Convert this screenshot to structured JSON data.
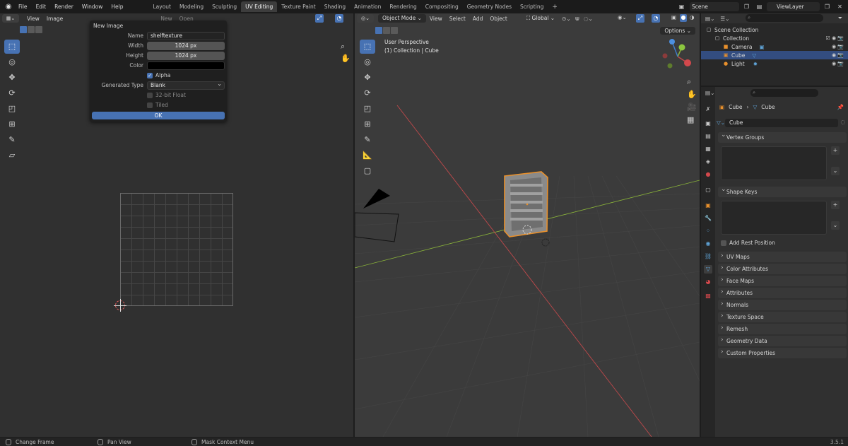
{
  "topbar": {
    "menus": [
      "File",
      "Edit",
      "Render",
      "Window",
      "Help"
    ],
    "workspaces": [
      "Layout",
      "Modeling",
      "Sculpting",
      "UV Editing",
      "Texture Paint",
      "Shading",
      "Animation",
      "Rendering",
      "Compositing",
      "Geometry Nodes",
      "Scripting"
    ],
    "active_workspace": "UV Editing",
    "add_label": "+",
    "scene": "Scene",
    "view_layer": "ViewLayer"
  },
  "uv_editor": {
    "menus": [
      "View",
      "Image"
    ],
    "new_label": "New",
    "open_label": "Open"
  },
  "new_image_dialog": {
    "title": "New Image",
    "name_label": "Name",
    "name_value": "shelftexture",
    "width_label": "Width",
    "width_value": "1024 px",
    "height_label": "Height",
    "height_value": "1024 px",
    "color_label": "Color",
    "color_value": "#000000",
    "alpha_label": "Alpha",
    "alpha_checked": true,
    "generated_type_label": "Generated Type",
    "generated_type_value": "Blank",
    "float_label": "32-bit Float",
    "tiled_label": "Tiled",
    "ok_label": "OK"
  },
  "viewport": {
    "mode": "Object Mode",
    "menus": [
      "View",
      "Select",
      "Add",
      "Object"
    ],
    "orientation": "Global",
    "options_label": "Options",
    "perspective": "User Perspective",
    "collection_info": "(1) Collection | Cube"
  },
  "outliner": {
    "scene_collection": "Scene Collection",
    "collection": "Collection",
    "items": [
      {
        "label": "Camera",
        "selected": false
      },
      {
        "label": "Cube",
        "selected": true
      },
      {
        "label": "Light",
        "selected": false
      }
    ]
  },
  "properties": {
    "breadcrumb_object": "Cube",
    "breadcrumb_separator": "›",
    "breadcrumb_data": "Cube",
    "mesh_name": "Cube",
    "panels": {
      "vertex_groups": "Vertex Groups",
      "shape_keys": "Shape Keys",
      "add_rest_position": "Add Rest Position",
      "collapsed": [
        "UV Maps",
        "Color Attributes",
        "Face Maps",
        "Attributes",
        "Normals",
        "Texture Space",
        "Remesh",
        "Geometry Data",
        "Custom Properties"
      ]
    }
  },
  "statusbar": {
    "left": "Change Frame",
    "middle": "Pan View",
    "right": "Mask Context Menu",
    "version": "3.5.1"
  },
  "colors": {
    "accent": "#4772b3",
    "object_outline": "#e8902c",
    "x_axis": "#c0494b",
    "y_axis": "#8ab33a"
  }
}
